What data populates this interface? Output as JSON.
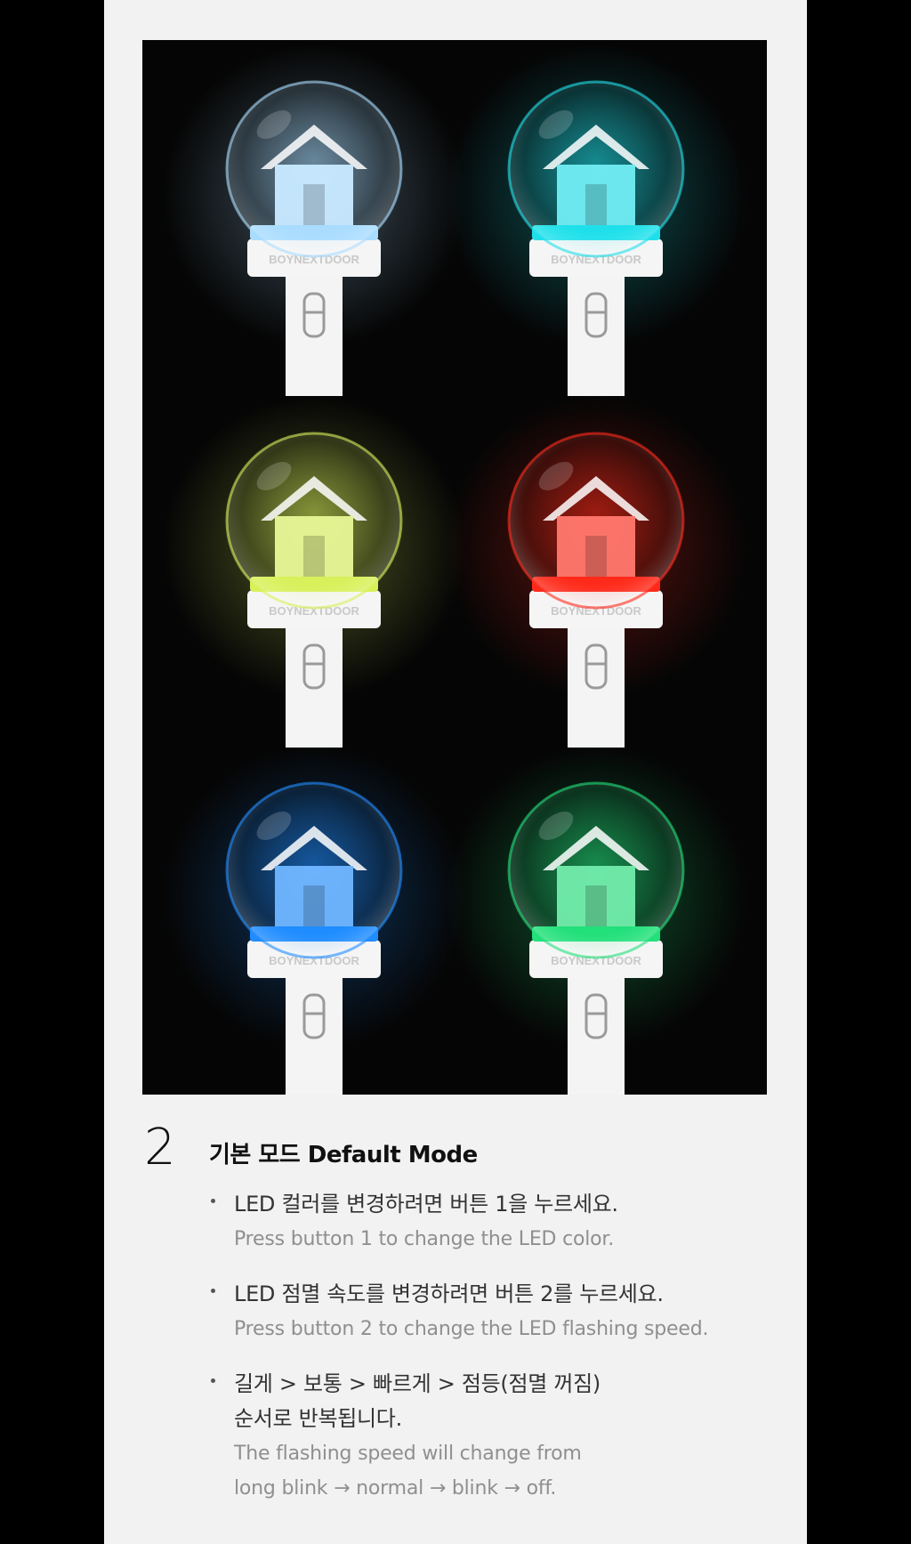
{
  "photo": {
    "stick_logo_text": "BOYNEXTDOOR",
    "stick_colors": [
      "#a9dcff",
      "#1fe0ea",
      "#d8f05a",
      "#ff2a1a",
      "#1f8cff",
      "#22e07a"
    ]
  },
  "step": {
    "number": "2",
    "title": "기본 모드 Default Mode"
  },
  "instructions": [
    {
      "ko": "LED 컬러를 변경하려면 버튼 1을 누르세요.",
      "en": "Press button 1 to change the LED color."
    },
    {
      "ko": "LED 점멸 속도를 변경하려면 버튼 2를 누르세요.",
      "en": "Press button 2 to change the LED flashing speed."
    },
    {
      "ko": "길게 > 보통 > 빠르게 > 점등(점멸 꺼짐)",
      "ko2": "순서로 반복됩니다.",
      "en": "The flashing speed will change from",
      "en2": "long blink → normal → blink → off."
    }
  ]
}
